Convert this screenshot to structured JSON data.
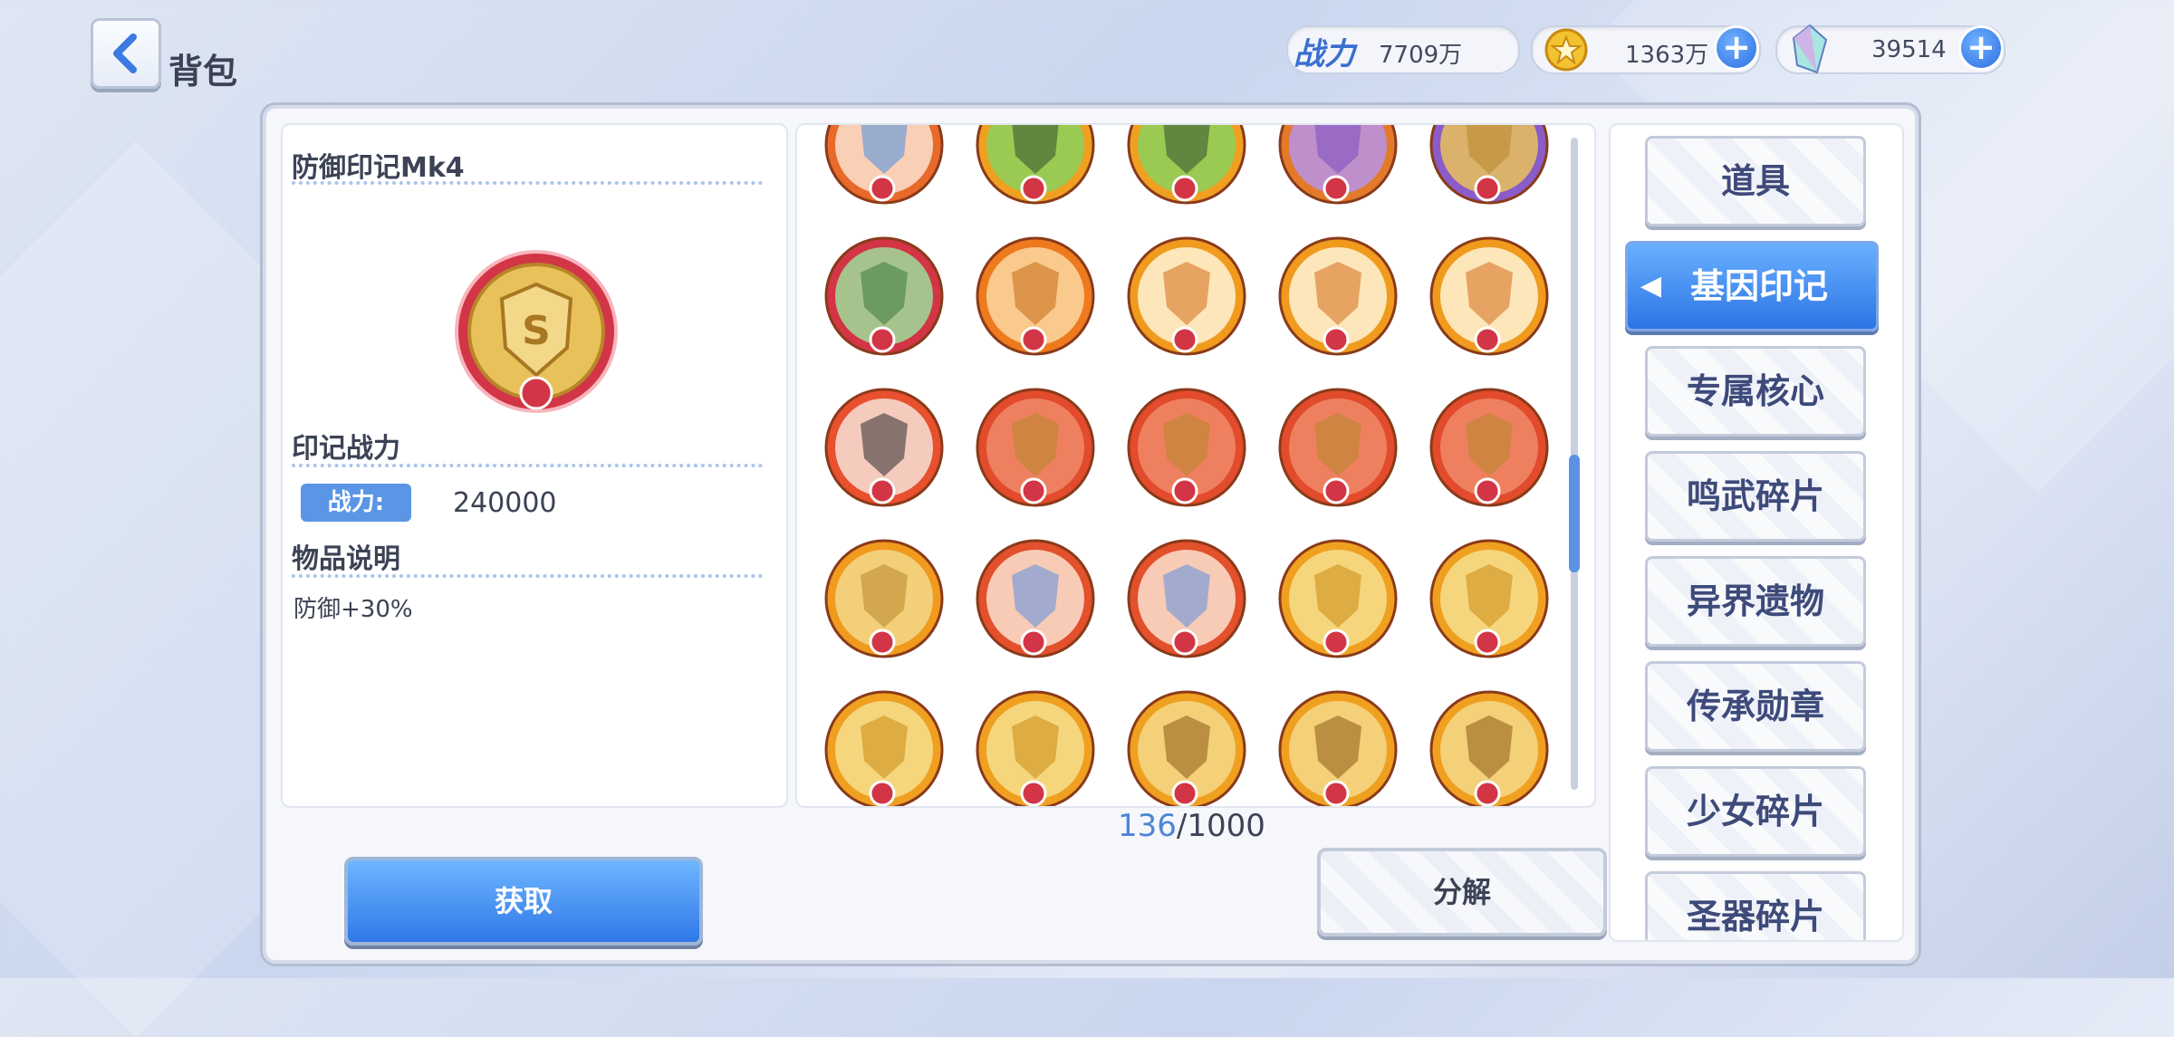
{
  "header": {
    "title": "背包",
    "back_icon": "chevron-left-icon"
  },
  "currencies": [
    {
      "name": "战力",
      "value": "7709万",
      "icon": "combat-power-badge-icon"
    },
    {
      "name": "gold-coin",
      "value": "1363万",
      "icon": "star-coin-icon",
      "plus": "+"
    },
    {
      "name": "crystal",
      "value": "39514",
      "icon": "crystal-gem-icon",
      "plus": "+"
    }
  ],
  "detail": {
    "item_name": "防御印记Mk4",
    "power_section_title": "印记战力",
    "power_label": "战力:",
    "power_value": "240000",
    "desc_section_title": "物品说明",
    "desc_text": "防御+30%"
  },
  "inventory": {
    "count_current": "136",
    "count_sep": "/",
    "count_max": "1000",
    "rows": [
      [
        "speech-arrow-emblem-icon",
        "green-gun-emblem-icon",
        "green-gun-emblem-icon",
        "purple-cross-emblem-icon",
        "gold-shield-emblem-icon"
      ],
      [
        "green-hair-emblem-icon",
        "crossed-shield-emblem-icon",
        "chibi-dodge-emblem-icon",
        "chibi-dodge-emblem-icon",
        "chibi-dodge-emblem-icon"
      ],
      [
        "black-figure-emblem-icon",
        "red-chainsaw-emblem-icon",
        "red-chainsaw-emblem-icon",
        "red-chainsaw-emblem-icon",
        "red-chainsaw-emblem-icon"
      ],
      [
        "gold-vest-emblem-icon",
        "sword-strike-emblem-icon",
        "sword-strike-emblem-icon",
        "gold-burst-shield-emblem-icon",
        "gold-burst-shield-emblem-icon"
      ],
      [
        "gold-burst-shield-emblem-icon",
        "gold-burst-shield-emblem-icon",
        "gold-cross-shield-emblem-icon",
        "gold-cross-shield-emblem-icon",
        "gold-cross-shield-emblem-icon"
      ]
    ]
  },
  "buttons": {
    "obtain": "获取",
    "decompose": "分解"
  },
  "tabs": [
    {
      "label": "道具",
      "active": false
    },
    {
      "label": "基因印记",
      "active": true
    },
    {
      "label": "专属核心",
      "active": false
    },
    {
      "label": "鸣武碎片",
      "active": false
    },
    {
      "label": "异界遗物",
      "active": false
    },
    {
      "label": "传承勋章",
      "active": false
    },
    {
      "label": "少女碎片",
      "active": false
    },
    {
      "label": "圣器碎片",
      "active": false
    }
  ],
  "colors": {
    "accent": "#2f78e8",
    "panel": "#f6f7fb",
    "text": "#3d4356"
  }
}
